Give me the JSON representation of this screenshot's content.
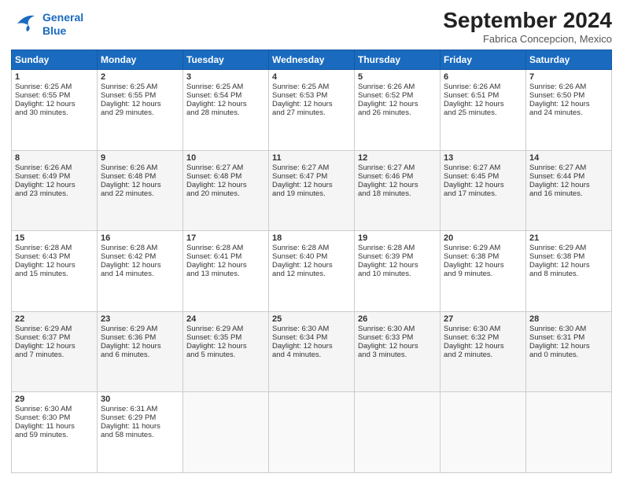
{
  "header": {
    "logo_line1": "General",
    "logo_line2": "Blue",
    "title": "September 2024",
    "location": "Fabrica Concepcion, Mexico"
  },
  "weekdays": [
    "Sunday",
    "Monday",
    "Tuesday",
    "Wednesday",
    "Thursday",
    "Friday",
    "Saturday"
  ],
  "weeks": [
    [
      {
        "day": "1",
        "lines": [
          "Sunrise: 6:25 AM",
          "Sunset: 6:55 PM",
          "Daylight: 12 hours",
          "and 30 minutes."
        ]
      },
      {
        "day": "2",
        "lines": [
          "Sunrise: 6:25 AM",
          "Sunset: 6:55 PM",
          "Daylight: 12 hours",
          "and 29 minutes."
        ]
      },
      {
        "day": "3",
        "lines": [
          "Sunrise: 6:25 AM",
          "Sunset: 6:54 PM",
          "Daylight: 12 hours",
          "and 28 minutes."
        ]
      },
      {
        "day": "4",
        "lines": [
          "Sunrise: 6:25 AM",
          "Sunset: 6:53 PM",
          "Daylight: 12 hours",
          "and 27 minutes."
        ]
      },
      {
        "day": "5",
        "lines": [
          "Sunrise: 6:26 AM",
          "Sunset: 6:52 PM",
          "Daylight: 12 hours",
          "and 26 minutes."
        ]
      },
      {
        "day": "6",
        "lines": [
          "Sunrise: 6:26 AM",
          "Sunset: 6:51 PM",
          "Daylight: 12 hours",
          "and 25 minutes."
        ]
      },
      {
        "day": "7",
        "lines": [
          "Sunrise: 6:26 AM",
          "Sunset: 6:50 PM",
          "Daylight: 12 hours",
          "and 24 minutes."
        ]
      }
    ],
    [
      {
        "day": "8",
        "lines": [
          "Sunrise: 6:26 AM",
          "Sunset: 6:49 PM",
          "Daylight: 12 hours",
          "and 23 minutes."
        ]
      },
      {
        "day": "9",
        "lines": [
          "Sunrise: 6:26 AM",
          "Sunset: 6:48 PM",
          "Daylight: 12 hours",
          "and 22 minutes."
        ]
      },
      {
        "day": "10",
        "lines": [
          "Sunrise: 6:27 AM",
          "Sunset: 6:48 PM",
          "Daylight: 12 hours",
          "and 20 minutes."
        ]
      },
      {
        "day": "11",
        "lines": [
          "Sunrise: 6:27 AM",
          "Sunset: 6:47 PM",
          "Daylight: 12 hours",
          "and 19 minutes."
        ]
      },
      {
        "day": "12",
        "lines": [
          "Sunrise: 6:27 AM",
          "Sunset: 6:46 PM",
          "Daylight: 12 hours",
          "and 18 minutes."
        ]
      },
      {
        "day": "13",
        "lines": [
          "Sunrise: 6:27 AM",
          "Sunset: 6:45 PM",
          "Daylight: 12 hours",
          "and 17 minutes."
        ]
      },
      {
        "day": "14",
        "lines": [
          "Sunrise: 6:27 AM",
          "Sunset: 6:44 PM",
          "Daylight: 12 hours",
          "and 16 minutes."
        ]
      }
    ],
    [
      {
        "day": "15",
        "lines": [
          "Sunrise: 6:28 AM",
          "Sunset: 6:43 PM",
          "Daylight: 12 hours",
          "and 15 minutes."
        ]
      },
      {
        "day": "16",
        "lines": [
          "Sunrise: 6:28 AM",
          "Sunset: 6:42 PM",
          "Daylight: 12 hours",
          "and 14 minutes."
        ]
      },
      {
        "day": "17",
        "lines": [
          "Sunrise: 6:28 AM",
          "Sunset: 6:41 PM",
          "Daylight: 12 hours",
          "and 13 minutes."
        ]
      },
      {
        "day": "18",
        "lines": [
          "Sunrise: 6:28 AM",
          "Sunset: 6:40 PM",
          "Daylight: 12 hours",
          "and 12 minutes."
        ]
      },
      {
        "day": "19",
        "lines": [
          "Sunrise: 6:28 AM",
          "Sunset: 6:39 PM",
          "Daylight: 12 hours",
          "and 10 minutes."
        ]
      },
      {
        "day": "20",
        "lines": [
          "Sunrise: 6:29 AM",
          "Sunset: 6:38 PM",
          "Daylight: 12 hours",
          "and 9 minutes."
        ]
      },
      {
        "day": "21",
        "lines": [
          "Sunrise: 6:29 AM",
          "Sunset: 6:38 PM",
          "Daylight: 12 hours",
          "and 8 minutes."
        ]
      }
    ],
    [
      {
        "day": "22",
        "lines": [
          "Sunrise: 6:29 AM",
          "Sunset: 6:37 PM",
          "Daylight: 12 hours",
          "and 7 minutes."
        ]
      },
      {
        "day": "23",
        "lines": [
          "Sunrise: 6:29 AM",
          "Sunset: 6:36 PM",
          "Daylight: 12 hours",
          "and 6 minutes."
        ]
      },
      {
        "day": "24",
        "lines": [
          "Sunrise: 6:29 AM",
          "Sunset: 6:35 PM",
          "Daylight: 12 hours",
          "and 5 minutes."
        ]
      },
      {
        "day": "25",
        "lines": [
          "Sunrise: 6:30 AM",
          "Sunset: 6:34 PM",
          "Daylight: 12 hours",
          "and 4 minutes."
        ]
      },
      {
        "day": "26",
        "lines": [
          "Sunrise: 6:30 AM",
          "Sunset: 6:33 PM",
          "Daylight: 12 hours",
          "and 3 minutes."
        ]
      },
      {
        "day": "27",
        "lines": [
          "Sunrise: 6:30 AM",
          "Sunset: 6:32 PM",
          "Daylight: 12 hours",
          "and 2 minutes."
        ]
      },
      {
        "day": "28",
        "lines": [
          "Sunrise: 6:30 AM",
          "Sunset: 6:31 PM",
          "Daylight: 12 hours",
          "and 0 minutes."
        ]
      }
    ],
    [
      {
        "day": "29",
        "lines": [
          "Sunrise: 6:30 AM",
          "Sunset: 6:30 PM",
          "Daylight: 11 hours",
          "and 59 minutes."
        ]
      },
      {
        "day": "30",
        "lines": [
          "Sunrise: 6:31 AM",
          "Sunset: 6:29 PM",
          "Daylight: 11 hours",
          "and 58 minutes."
        ]
      },
      {
        "day": "",
        "lines": []
      },
      {
        "day": "",
        "lines": []
      },
      {
        "day": "",
        "lines": []
      },
      {
        "day": "",
        "lines": []
      },
      {
        "day": "",
        "lines": []
      }
    ]
  ]
}
